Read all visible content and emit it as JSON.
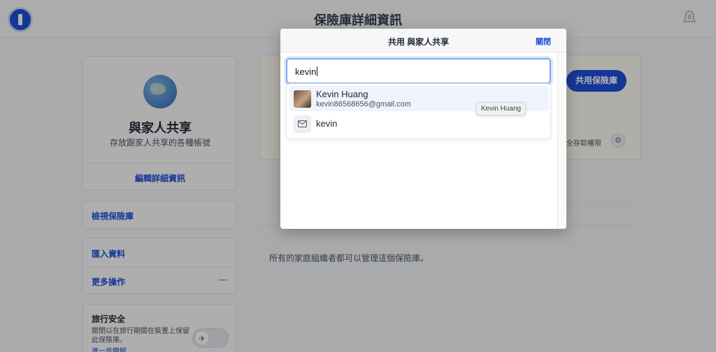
{
  "header": {
    "title": "保險庫詳細資訊",
    "notification_count": "0"
  },
  "vault": {
    "name": "與家人共享",
    "description": "存放跟家人共享的各種帳號",
    "edit_label": "編輯詳細資訊"
  },
  "sidebar": {
    "view_vault": "檢視保險庫",
    "import_data": "匯入資料",
    "more_actions": "更多操作",
    "more_dots": "···"
  },
  "travel": {
    "title": "旅行安全",
    "description": "關閉以在旅行期間在裝置上保留此保險庫。",
    "learn_more": "進一步瞭解…"
  },
  "main": {
    "share_button": "共用保險庫",
    "permissions_text": "完全存取權限",
    "family_note": "所有的家庭組織者都可以管理這個保險庫。"
  },
  "modal": {
    "title": "共用 與家人共享",
    "close_label": "關閉"
  },
  "search": {
    "value": "kevin"
  },
  "results": [
    {
      "name": "Kevin Huang",
      "email": "kevin86568656@gmail.com"
    },
    {
      "name": "kevin"
    }
  ],
  "tooltip": "Kevin Huang",
  "colors": {
    "accent": "#1d4ed8",
    "focus": "#7da6f0"
  }
}
